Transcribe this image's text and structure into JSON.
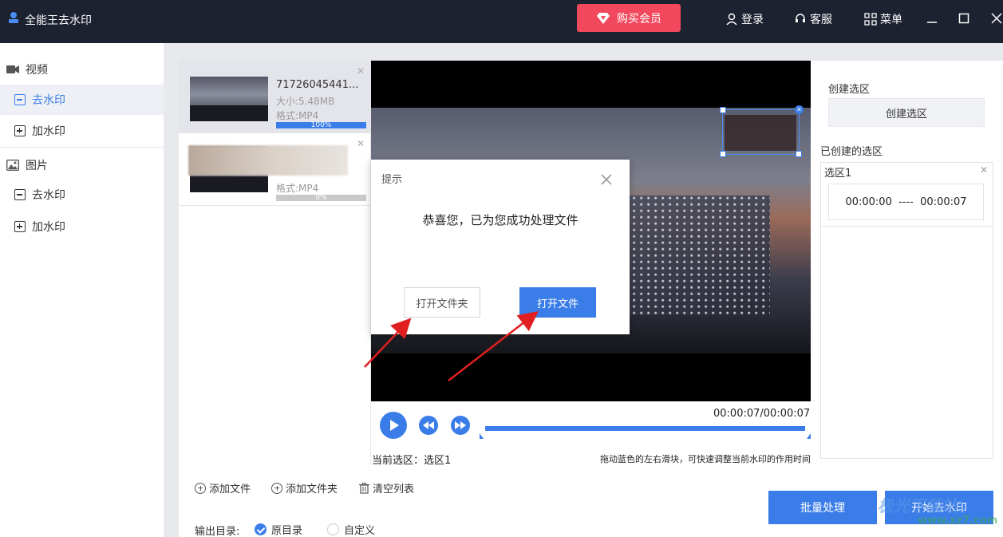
{
  "app": {
    "title": "全能王去水印",
    "vip_label": "购买会员",
    "login_label": "登录",
    "service_label": "客服",
    "menu_label": "菜单"
  },
  "sidebar": {
    "video_group": "视频",
    "video_items": [
      "去水印",
      "加水印"
    ],
    "image_group": "图片",
    "image_items": [
      "去水印",
      "加水印"
    ]
  },
  "files": [
    {
      "name": "71726045441...",
      "size": "大小:5.48MB",
      "format": "格式:MP4",
      "progress": 1.0,
      "progress_text": "100%"
    },
    {
      "name": "",
      "size": "",
      "format": "格式:MP4",
      "progress": 0.0,
      "progress_text": "0%"
    }
  ],
  "player": {
    "current_time": "00:00:07",
    "total_time": "00:00:07",
    "separator": "/",
    "current_selection": "当前选区：选区1",
    "hint": "拖动蓝色的左右滑块，可快速调整当前水印的作用时间"
  },
  "right_panel": {
    "title": "创建选区",
    "create_button": "创建选区",
    "created_title": "已创建的选区",
    "region_name": "选区1",
    "region_start": "00:00:00",
    "region_sep": "----",
    "region_end": "00:00:07"
  },
  "bottom": {
    "add_file": "添加文件",
    "add_folder": "添加文件夹",
    "clear_list": "清空列表",
    "output_label": "输出目录:",
    "radio_original": "原目录",
    "radio_custom": "自定义",
    "batch_button": "批量处理",
    "start_button": "开始去水印"
  },
  "modal": {
    "title": "提示",
    "message": "恭喜您，已为您成功处理文件",
    "open_folder": "打开文件夹",
    "open_file": "打开文件"
  },
  "watermark": {
    "text": "极光下载站",
    "sub": "www.xz7.com"
  },
  "colors": {
    "accent": "#3b7de8",
    "titlebar": "#1d2230",
    "vip": "#f2485d"
  }
}
